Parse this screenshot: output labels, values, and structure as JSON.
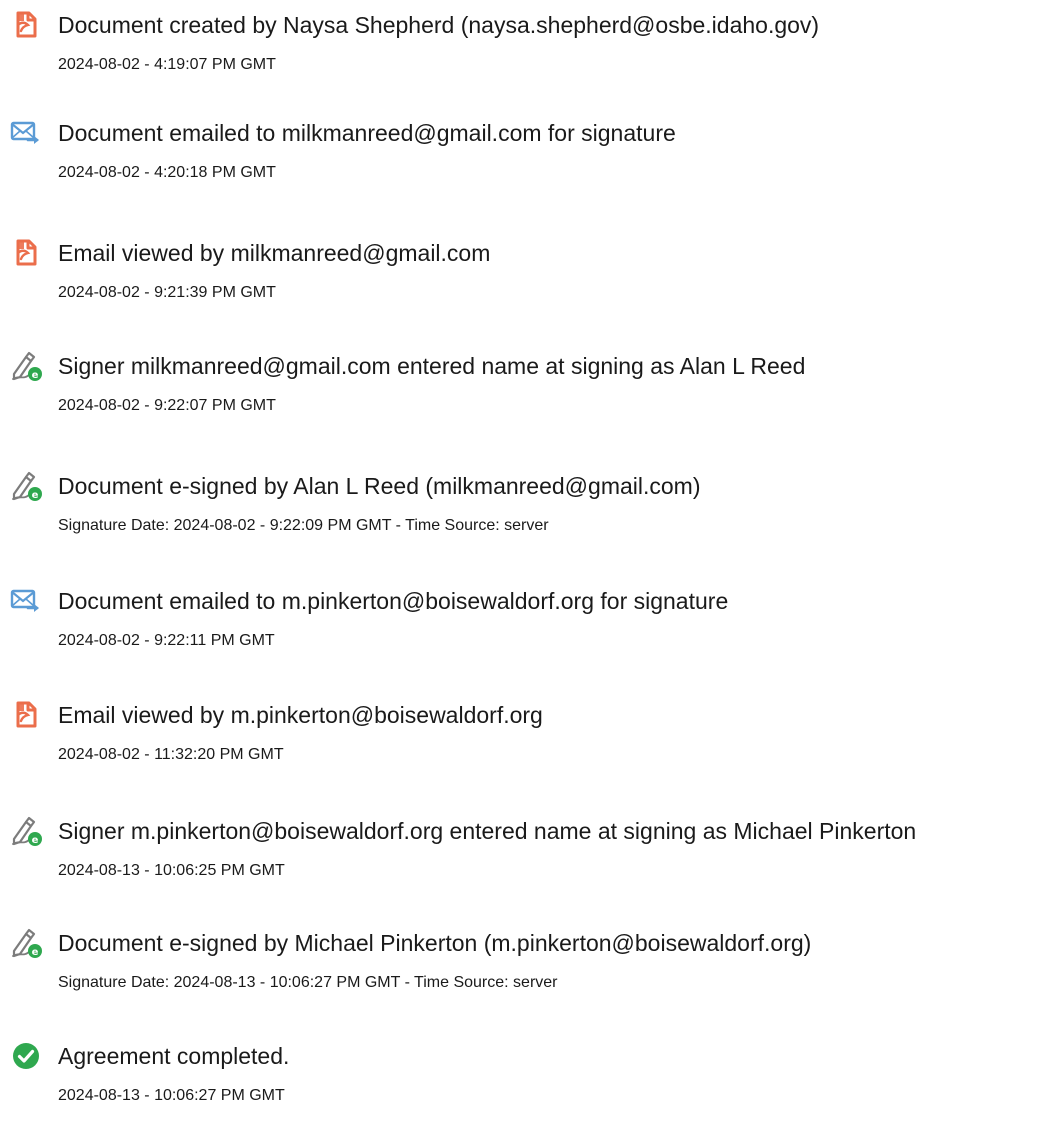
{
  "events": [
    {
      "icon": "document-icon",
      "title": "Document created by Naysa Shepherd (naysa.shepherd@osbe.idaho.gov)",
      "time": "2024-08-02 - 4:19:07 PM GMT"
    },
    {
      "icon": "email-send-icon",
      "title": "Document emailed to milkmanreed@gmail.com for signature",
      "time": "2024-08-02 - 4:20:18 PM GMT"
    },
    {
      "icon": "document-icon",
      "title": "Email viewed by milkmanreed@gmail.com",
      "time": "2024-08-02 - 9:21:39 PM GMT"
    },
    {
      "icon": "esign-pen-icon",
      "title": "Signer milkmanreed@gmail.com entered name at signing as Alan L Reed",
      "time": "2024-08-02 - 9:22:07 PM GMT"
    },
    {
      "icon": "esign-pen-icon",
      "title": "Document e-signed by Alan L Reed (milkmanreed@gmail.com)",
      "time": "Signature Date: 2024-08-02 - 9:22:09 PM GMT - Time Source: server"
    },
    {
      "icon": "email-send-icon",
      "title": "Document emailed to m.pinkerton@boisewaldorf.org for signature",
      "time": "2024-08-02 - 9:22:11 PM GMT"
    },
    {
      "icon": "document-icon",
      "title": "Email viewed by m.pinkerton@boisewaldorf.org",
      "time": "2024-08-02 - 11:32:20 PM GMT"
    },
    {
      "icon": "esign-pen-icon",
      "title": "Signer m.pinkerton@boisewaldorf.org entered name at signing as Michael Pinkerton",
      "time": "2024-08-13 - 10:06:25 PM GMT"
    },
    {
      "icon": "esign-pen-icon",
      "title": "Document e-signed by Michael Pinkerton (m.pinkerton@boisewaldorf.org)",
      "time": "Signature Date: 2024-08-13 - 10:06:27 PM GMT - Time Source: server"
    },
    {
      "icon": "checkmark-circle-icon",
      "title": "Agreement completed.",
      "time": "2024-08-13 - 10:06:27 PM GMT"
    }
  ],
  "colors": {
    "document_icon": "#EB6E4B",
    "email_icon": "#5B9BD5",
    "pen_icon": "#7C7C7C",
    "pen_badge": "#2FA84F",
    "check_badge": "#2FA84F",
    "text": "#1A1A1A"
  }
}
